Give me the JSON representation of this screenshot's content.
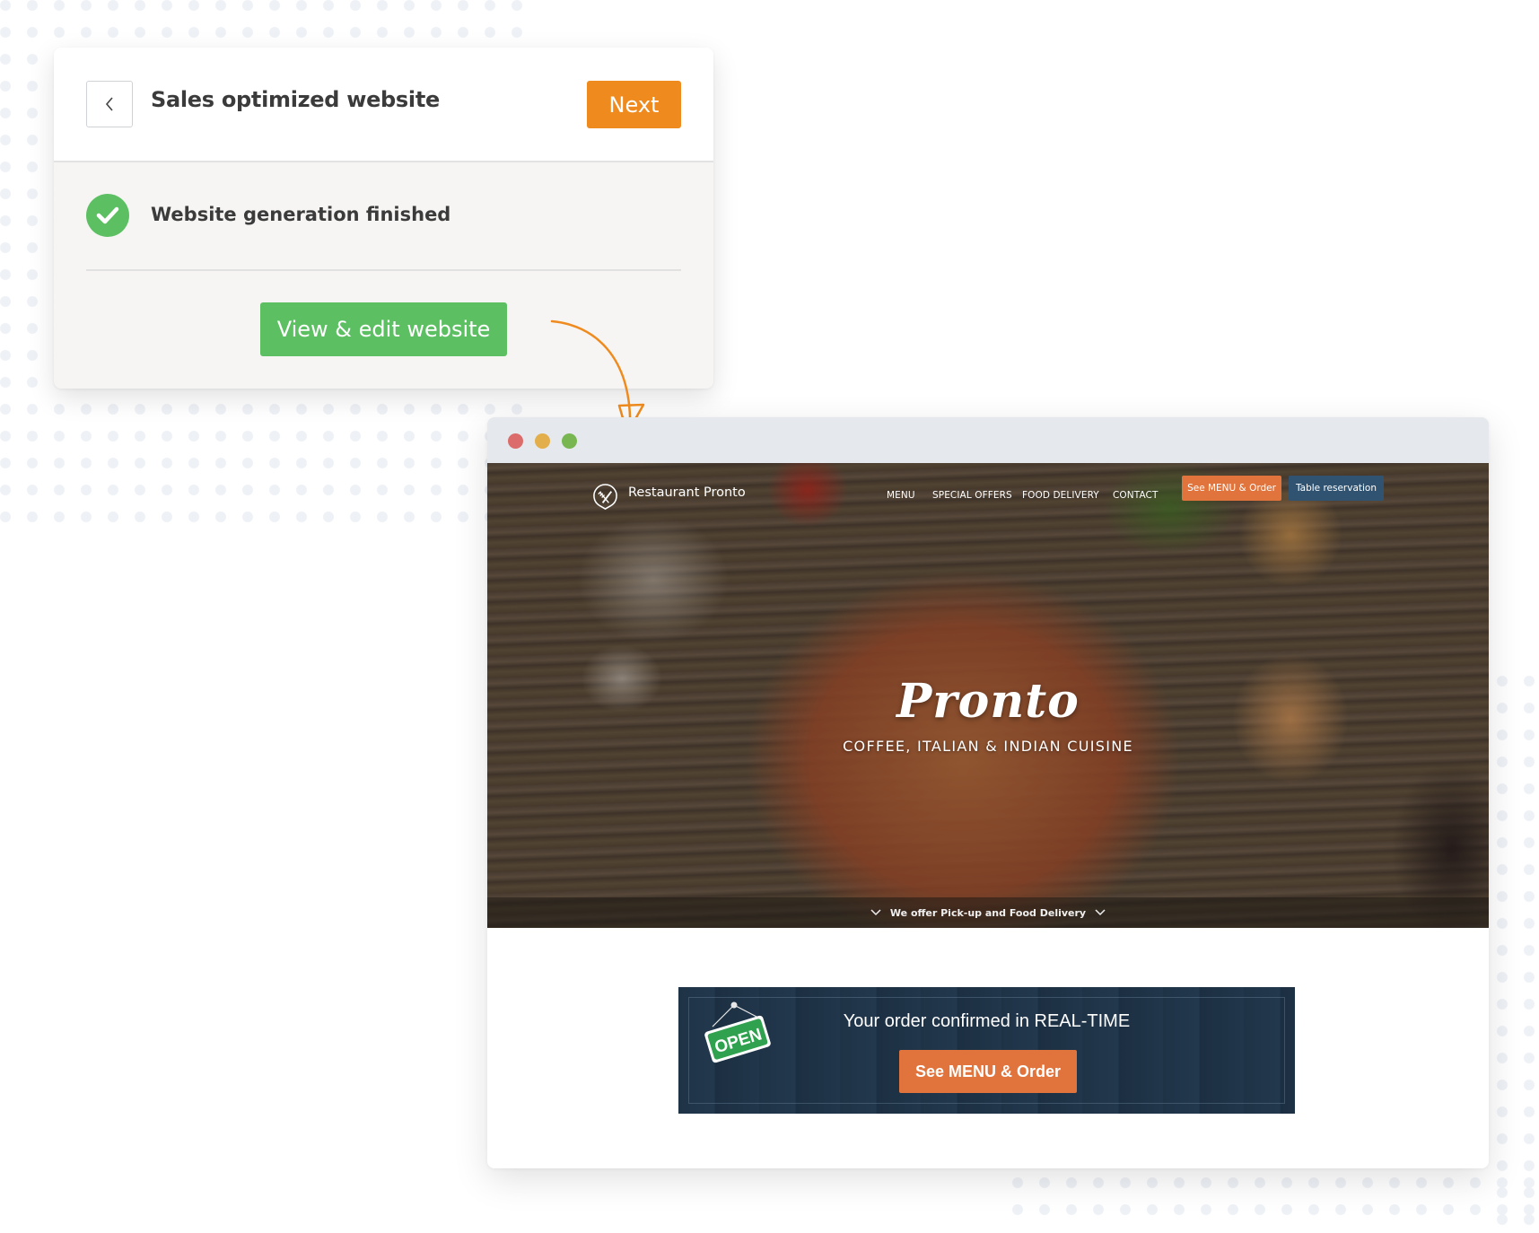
{
  "wizard": {
    "title": "Sales optimized website",
    "back_icon": "chevron-left-icon",
    "next_label": "Next",
    "status_icon": "check-circle-icon",
    "status_text": "Website generation finished",
    "view_edit_label": "View & edit website"
  },
  "browser": {
    "window_controls": [
      "close",
      "minimize",
      "maximize"
    ],
    "site": {
      "brand_icon": "fork-knife-icon",
      "brand_name": "Restaurant Pronto",
      "nav": [
        "MENU",
        "SPECIAL OFFERS",
        "FOOD DELIVERY",
        "CONTACT"
      ],
      "cta_order": "See MENU & Order",
      "cta_reserve": "Table reservation",
      "hero_title": "Pronto",
      "hero_subtitle": "COFFEE, ITALIAN & INDIAN CUISINE",
      "hero_strip": "We offer Pick-up and Food Delivery",
      "banner": {
        "sign_text": "OPEN",
        "headline": "Your order confirmed in REAL-TIME",
        "button": "See MENU & Order"
      }
    }
  },
  "colors": {
    "accent_orange": "#ef8b1e",
    "success_green": "#5cc063",
    "site_orange": "#e0743c",
    "site_blue": "#2f5371",
    "banner_navy": "#213649"
  }
}
